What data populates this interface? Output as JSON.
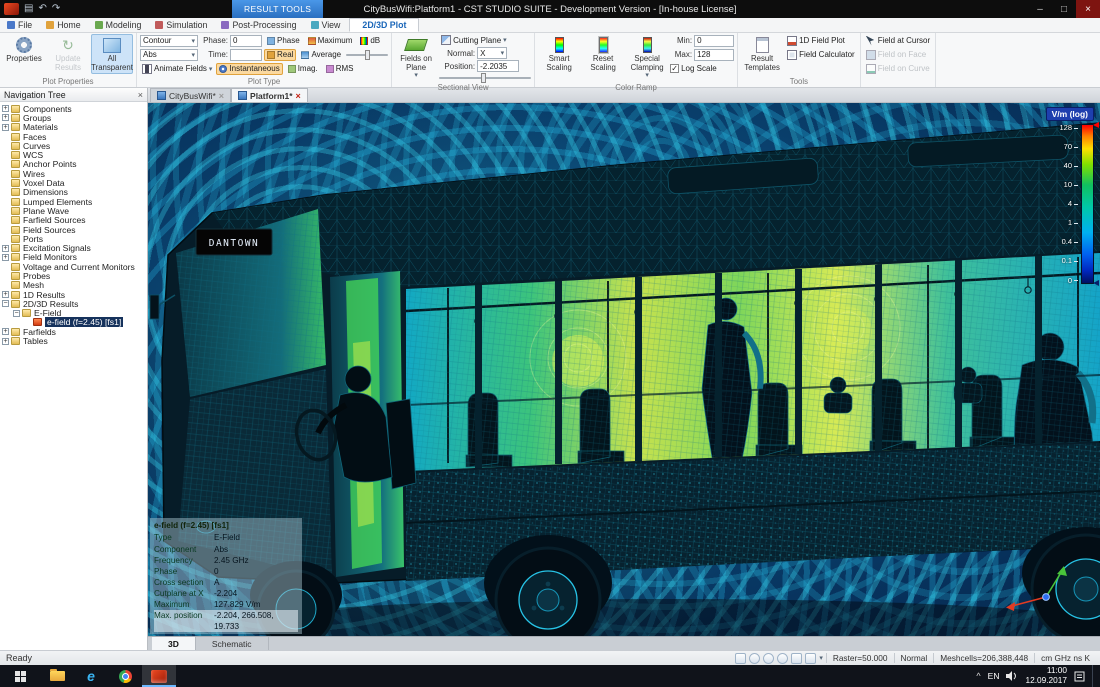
{
  "titlebar": {
    "title": "CityBusWifi:Platform1 - CST STUDIO SUITE - Development Version - [In-house License]",
    "context_tab": "RESULT TOOLS"
  },
  "tabs": {
    "menu": [
      "File",
      "Home",
      "Modeling",
      "Simulation",
      "Post-Processing",
      "View"
    ],
    "active_plot_tab": "2D/3D Plot"
  },
  "ribbon": {
    "plot_properties": {
      "label": "Plot Properties",
      "properties": "Properties",
      "update_results": "Update Results",
      "all_transparent": "All Transparent"
    },
    "plot_type": {
      "label": "Plot Type",
      "contour": "Contour",
      "abs": "Abs",
      "animate": "Animate Fields",
      "phase_label": "Phase:",
      "phase_value": "0",
      "time_label": "Time:",
      "time_value": "",
      "phase_toggle": "Phase",
      "real": "Real",
      "imag": "Imag.",
      "rms": "RMS",
      "maximum": "Maximum",
      "average": "Average",
      "db": "dB",
      "instantaneous": "Instantaneous"
    },
    "sectional": {
      "label": "Sectional View",
      "fields_on_plane": "Fields on Plane",
      "cutting_plane": "Cutting Plane",
      "normal_label": "Normal:",
      "normal_value": "X",
      "position_label": "Position:",
      "position_value": "-2.2035"
    },
    "color_ramp": {
      "label": "Color Ramp",
      "smart": "Smart Scaling",
      "reset": "Reset Scaling",
      "clamping": "Special Clamping",
      "min_label": "Min:",
      "min_value": "0",
      "max_label": "Max:",
      "max_value": "128",
      "log_scale": "Log Scale"
    },
    "tools": {
      "label": "Tools",
      "result_templates": "Result Templates",
      "field_plot_1d": "1D Field Plot",
      "field_calculator": "Field Calculator"
    },
    "field_tools": {
      "label": "",
      "at_cursor": "Field at Cursor",
      "on_face": "Field on Face",
      "on_curve": "Field on Curve"
    }
  },
  "nav": {
    "title": "Navigation Tree",
    "items": [
      {
        "label": "Components",
        "exp": "+",
        "depth": 0,
        "icon": "folder",
        "state": ""
      },
      {
        "label": "Groups",
        "exp": "+",
        "depth": 0,
        "icon": "folder",
        "state": ""
      },
      {
        "label": "Materials",
        "exp": "+",
        "depth": 0,
        "icon": "folder",
        "state": ""
      },
      {
        "label": "Faces",
        "exp": "",
        "depth": 0,
        "icon": "folder",
        "state": ""
      },
      {
        "label": "Curves",
        "exp": "",
        "depth": 0,
        "icon": "folder",
        "state": ""
      },
      {
        "label": "WCS",
        "exp": "",
        "depth": 0,
        "icon": "folder",
        "state": ""
      },
      {
        "label": "Anchor Points",
        "exp": "",
        "depth": 0,
        "icon": "folder",
        "state": ""
      },
      {
        "label": "Wires",
        "exp": "",
        "depth": 0,
        "icon": "folder",
        "state": ""
      },
      {
        "label": "Voxel Data",
        "exp": "",
        "depth": 0,
        "icon": "folder",
        "state": ""
      },
      {
        "label": "Dimensions",
        "exp": "",
        "depth": 0,
        "icon": "folder",
        "state": ""
      },
      {
        "label": "Lumped Elements",
        "exp": "",
        "depth": 0,
        "icon": "folder",
        "state": ""
      },
      {
        "label": "Plane Wave",
        "exp": "",
        "depth": 0,
        "icon": "folder",
        "state": ""
      },
      {
        "label": "Farfield Sources",
        "exp": "",
        "depth": 0,
        "icon": "folder",
        "state": ""
      },
      {
        "label": "Field Sources",
        "exp": "",
        "depth": 0,
        "icon": "folder",
        "state": ""
      },
      {
        "label": "Ports",
        "exp": "",
        "depth": 0,
        "icon": "folder",
        "state": ""
      },
      {
        "label": "Excitation Signals",
        "exp": "+",
        "depth": 0,
        "icon": "folder",
        "state": ""
      },
      {
        "label": "Field Monitors",
        "exp": "+",
        "depth": 0,
        "icon": "folder",
        "state": ""
      },
      {
        "label": "Voltage and Current Monitors",
        "exp": "",
        "depth": 0,
        "icon": "folder",
        "state": ""
      },
      {
        "label": "Probes",
        "exp": "",
        "depth": 0,
        "icon": "folder",
        "state": ""
      },
      {
        "label": "Mesh",
        "exp": "",
        "depth": 0,
        "icon": "folder",
        "state": ""
      },
      {
        "label": "1D Results",
        "exp": "+",
        "depth": 0,
        "icon": "folder",
        "state": ""
      },
      {
        "label": "2D/3D Results",
        "exp": "−",
        "depth": 0,
        "icon": "folder",
        "state": ""
      },
      {
        "label": "E-Field",
        "exp": "−",
        "depth": 1,
        "icon": "folder",
        "state": ""
      },
      {
        "label": "e-field (f=2.45) [fs1]",
        "exp": "",
        "depth": 2,
        "icon": "result",
        "state": "selected"
      },
      {
        "label": "Farfields",
        "exp": "+",
        "depth": 0,
        "icon": "folder",
        "state": ""
      },
      {
        "label": "Tables",
        "exp": "+",
        "depth": 0,
        "icon": "folder",
        "state": ""
      }
    ]
  },
  "doc_tabs": [
    {
      "label": "CityBusWifi*"
    },
    {
      "label": "Platform1*"
    }
  ],
  "viewport": {
    "sign_text": "DANTOWN",
    "legend": {
      "title": "V/m (log)",
      "ticks": [
        "128",
        "70",
        "40",
        "10",
        "4",
        "1",
        "0.4",
        "0.1",
        "0"
      ]
    },
    "info": {
      "title": "e-field (f=2.45) [fs1]",
      "rows": [
        {
          "label": "Type",
          "value": "E-Field"
        },
        {
          "label": "Component",
          "value": "Abs"
        },
        {
          "label": "Frequency",
          "value": "2.45 GHz"
        },
        {
          "label": "Phase",
          "value": "0"
        },
        {
          "label": "Cross section",
          "value": "A"
        },
        {
          "label": "Cutplane at X",
          "value": "-2.204"
        },
        {
          "label": "Maximum",
          "value": "127.829 V/m"
        },
        {
          "label": "Max. position",
          "value": "-2.204, 266.508, 19.733"
        }
      ]
    }
  },
  "bottom_tabs": [
    {
      "label": "3D"
    },
    {
      "label": "Schematic"
    }
  ],
  "statusbar": {
    "ready": "Ready",
    "segments": [
      "Raster=50.000",
      "Normal",
      "Meshcells=206,388,448",
      "cm GHz ns K"
    ]
  },
  "taskbar": {
    "lang": "EN",
    "time": "11:00",
    "date": "12.09.2017"
  },
  "icons": {
    "dropdown": "▾",
    "close": "×",
    "minimize": "–",
    "maximize": "□",
    "check": "✓",
    "caret_up": "^",
    "refresh": "↻",
    "save": "▤",
    "undo": "↶",
    "redo": "↷",
    "edge_e": "e"
  },
  "colors": {
    "context_tab_blue": "#2e7cd6",
    "ribbon_highlight": "#fbd9a0",
    "selection_navy": "#16325c",
    "legend_title_blue": "#1e3fae",
    "cst_red": "#d6341c",
    "field_max_red": "#ff0000",
    "field_min_blue": "#001060"
  }
}
